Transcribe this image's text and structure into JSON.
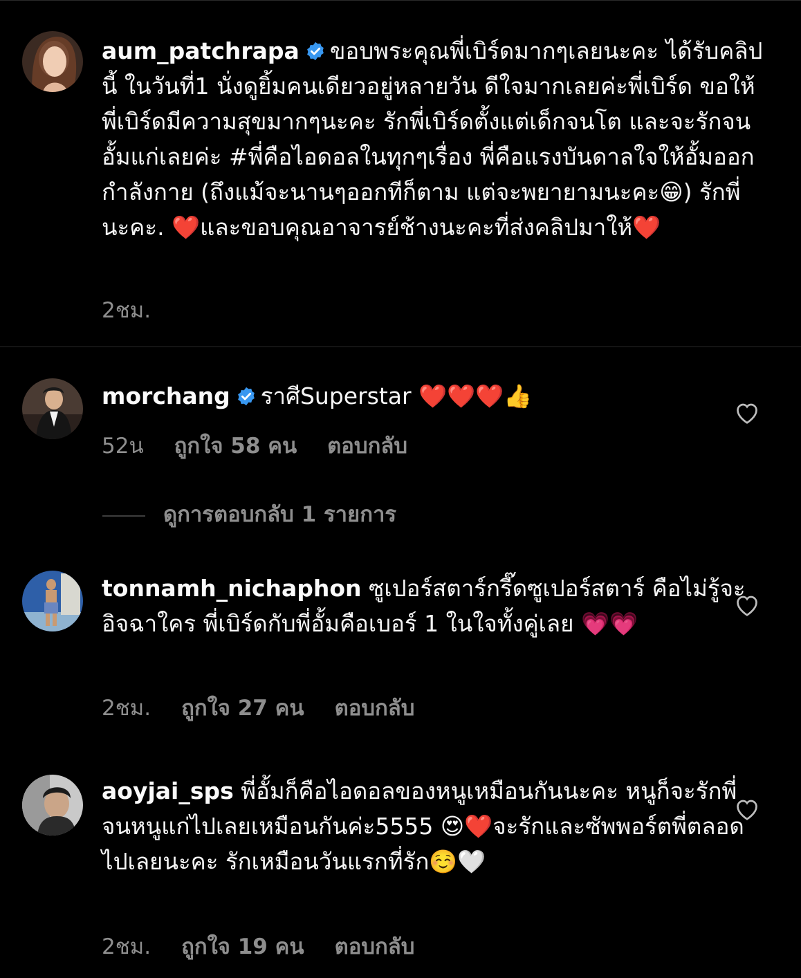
{
  "comments": [
    {
      "username": "aum_patchrapa",
      "text": "ขอบพระคุณพี่เบิร์ดมากๆเลยนะคะ ได้รับคลิปนี้ ในวันที่1 นั่งดูยิ้มคนเดียวอยู่หลายวัน ดีใจมากเลยค่ะพี่เบิร์ด ขอให้พี่เบิร์ดมีความสุขมากๆนะคะ รักพี่เบิร์ดตั้งแต่เด็กจนโต และจะรักจนอั้มแก่เลยค่ะ  #พี่คือไอดอลในทุกๆเรื่อง พี่คือแรงบันดาลใจให้อั้มออกกำลังกาย (ถึงแม้จะนานๆออกทีก็ตาม แต่จะพยายามนะคะ😁) รักพี่นะคะ. ❤️และขอบคุณอาจารย์ช้างนะคะที่ส่งคลิปมาให้❤️",
      "time": "2ชม.",
      "verified": true
    },
    {
      "username": "morchang",
      "text": "ราศีSuperstar ❤️❤️❤️👍",
      "time": "52น",
      "likes": "ถูกใจ 58 คน",
      "reply": "ตอบกลับ",
      "view_replies": "ดูการตอบกลับ 1 รายการ",
      "verified": true
    },
    {
      "username": "tonnamh_nichaphon",
      "text": "ซูเปอร์สตาร์กรี๊ดซูเปอร์สตาร์ คือไม่รู้จะอิจฉาใคร พี่เบิร์ดกับพี่อั้มคือเบอร์ 1 ในใจทั้งคู่เลย 💗💗",
      "time": "2ชม.",
      "likes": "ถูกใจ 27 คน",
      "reply": "ตอบกลับ"
    },
    {
      "username": "aoyjai_sps",
      "text": "พี่อั้มก็คือไอดอลของหนูเหมือนกันนะคะ หนูก็จะรักพี่จนหนูแก่ไปเลยเหมือนกันค่ะ5555 😍❤️จะรักและซัพพอร์ตพี่ตลอดไปเลยนะคะ รักเหมือนวันแรกที่รัก☺️🤍",
      "time": "2ชม.",
      "likes": "ถูกใจ 19 คน",
      "reply": "ตอบกลับ"
    }
  ],
  "colors": {
    "background": "#000000",
    "text": "#f5f5f5",
    "meta": "#8e8e8e",
    "verified": "#3897f0"
  },
  "icons": {
    "verified": "verified-badge-icon",
    "like": "heart-outline-icon"
  }
}
